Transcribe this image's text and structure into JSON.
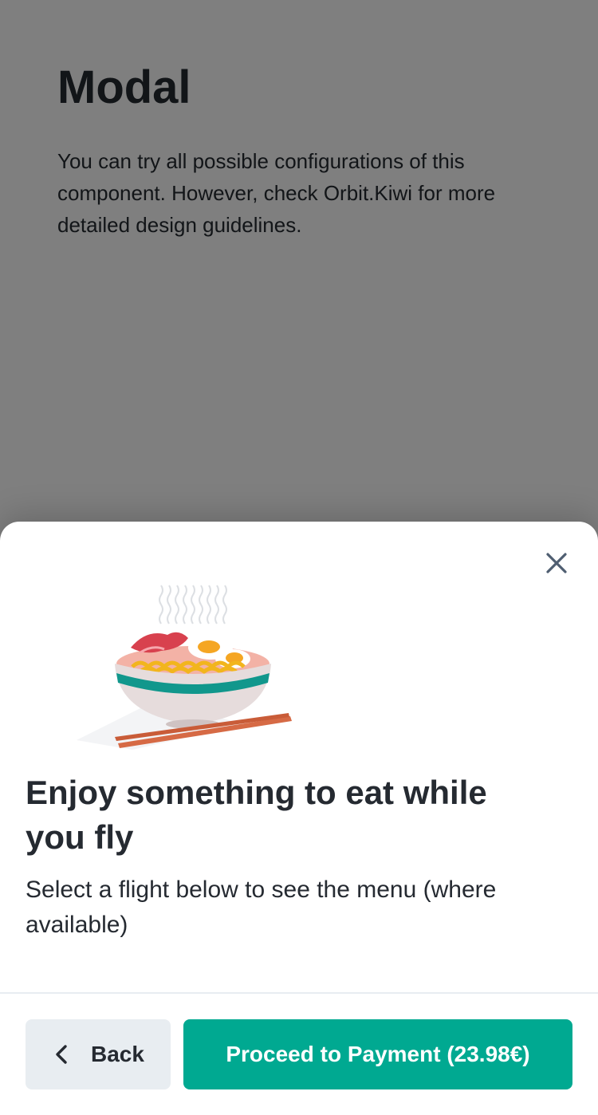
{
  "background_page": {
    "title": "Modal",
    "description": "You can try all possible configurations of this component. However, check Orbit.Kiwi for more detailed design guidelines."
  },
  "modal": {
    "illustration": "noodle-bowl-with-chopsticks",
    "title": "Enjoy something to eat while you fly",
    "description": "Select a flight below to see the menu (where available)",
    "close_icon": "close-icon",
    "footer": {
      "back_label": "Back",
      "back_icon": "chevron-left-icon",
      "primary_label": "Proceed to Payment (23.98€)"
    }
  },
  "colors": {
    "primary": "#00a991",
    "secondary_button": "#e8edf1",
    "text": "#252a31",
    "overlay": "rgba(0,0,0,0.5)"
  }
}
